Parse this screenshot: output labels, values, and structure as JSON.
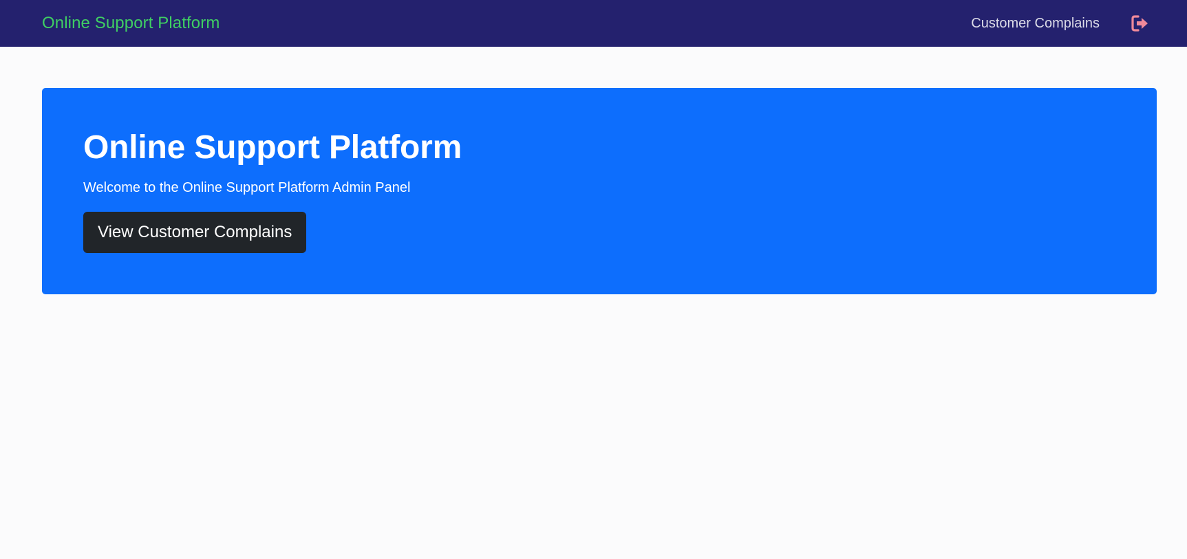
{
  "navbar": {
    "brand": "Online Support Platform",
    "nav_link": "Customer Complains",
    "logout_icon": "sign-out-icon",
    "brand_color": "#3fcf63",
    "background_color": "#24216e",
    "logout_color": "#f08a9a"
  },
  "hero": {
    "title": "Online Support Platform",
    "subtitle": "Welcome to the Online Support Platform Admin Panel",
    "button_label": "View Customer Complains",
    "background_color": "#0d6efd",
    "button_color": "#212529"
  }
}
